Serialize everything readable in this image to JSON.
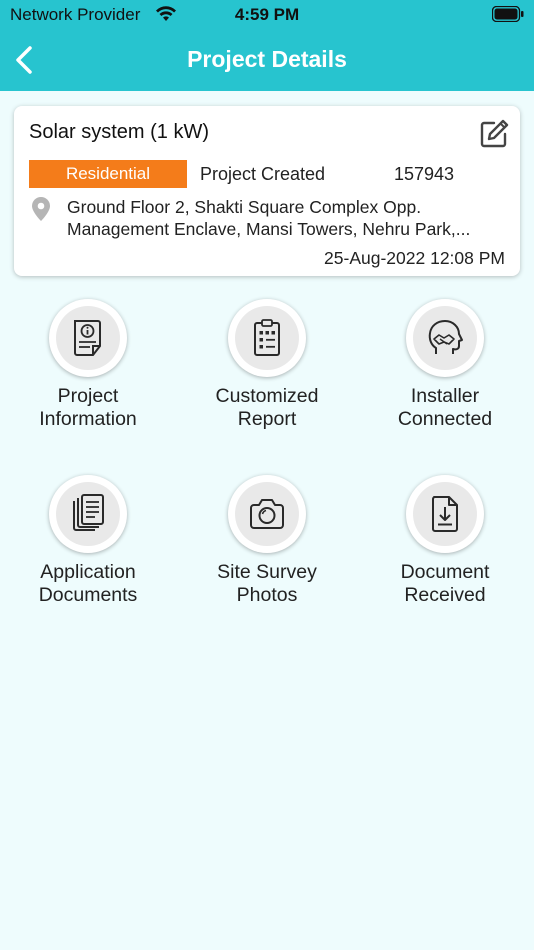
{
  "status_bar": {
    "carrier": "Network Provider",
    "time": "4:59 PM"
  },
  "nav": {
    "title": "Project Details",
    "back_icon": "chevron-left-icon"
  },
  "project": {
    "title": "Solar system (1 kW)",
    "category": "Residential",
    "category_color": "#f47c1a",
    "status": "Project Created",
    "id": "157943",
    "address_line1": "Ground Floor 2, Shakti Square Complex Opp.",
    "address_line2": "Management Enclave, Mansi Towers, Nehru Park,...",
    "datetime": "25-Aug-2022 12:08 PM"
  },
  "tiles": [
    {
      "line1": "Project",
      "line2": "Information",
      "icon": "info-document-icon"
    },
    {
      "line1": "Customized",
      "line2": "Report",
      "icon": "report-checklist-icon"
    },
    {
      "line1": "Installer",
      "line2": "Connected",
      "icon": "handshake-head-icon"
    },
    {
      "line1": "Application",
      "line2": "Documents",
      "icon": "documents-stack-icon"
    },
    {
      "line1": "Site Survey",
      "line2": "Photos",
      "icon": "camera-icon"
    },
    {
      "line1": "Document",
      "line2": "Received",
      "icon": "download-file-icon"
    }
  ],
  "colors": {
    "header": "#27c4cf",
    "background": "#eefcfd"
  }
}
